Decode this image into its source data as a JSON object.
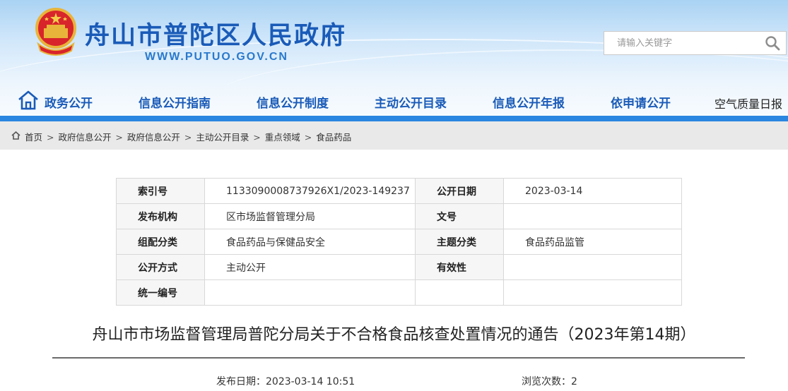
{
  "header": {
    "site_title": "舟山市普陀区人民政府",
    "site_url": "WWW.PUTUO.GOV.CN",
    "search_placeholder": "请输入关键字",
    "brand_color": "#1a5bb8"
  },
  "nav": {
    "items": [
      {
        "label": "政务公开",
        "icon": "home-icon"
      },
      {
        "label": "信息公开指南"
      },
      {
        "label": "信息公开制度"
      },
      {
        "label": "主动公开目录"
      },
      {
        "label": "信息公开年报"
      },
      {
        "label": "依申请公开"
      },
      {
        "label": "空气质量日报"
      }
    ],
    "bar_color": "#2a86e0"
  },
  "breadcrumb": [
    "首页",
    "政府信息公开",
    "政府信息公开",
    "主动公开目录",
    "重点领域",
    "食品药品"
  ],
  "meta": {
    "rows": [
      {
        "k1": "索引号",
        "v1": "1133090008737926X1/2023-149237",
        "k2": "公开日期",
        "v2": "2023-03-14"
      },
      {
        "k1": "发布机构",
        "v1": "区市场监督管理分局",
        "k2": "文号",
        "v2": ""
      },
      {
        "k1": "组配分类",
        "v1": "食品药品与保健品安全",
        "k2": "主题分类",
        "v2": "食品药品监管"
      },
      {
        "k1": "公开方式",
        "v1": "主动公开",
        "k2": "有效性",
        "v2": ""
      },
      {
        "k1": "统一编号",
        "v1": "",
        "k2": "",
        "v2": ""
      }
    ]
  },
  "article": {
    "title": "舟山市市场监督管理局普陀分局关于不合格食品核查处置情况的通告（2023年第14期）",
    "pub_date": "发布日期：2023-03-14 10:51",
    "views": "浏览次数：2"
  }
}
